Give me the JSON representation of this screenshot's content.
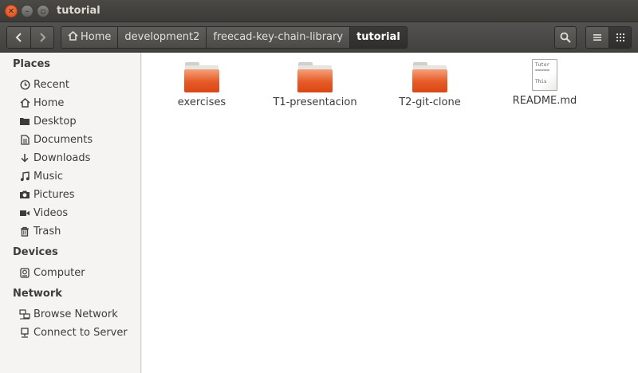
{
  "window": {
    "title": "tutorial"
  },
  "toolbar": {
    "back_icon": "chevron-left-icon",
    "forward_icon": "chevron-right-icon",
    "breadcrumbs": [
      {
        "label": "Home",
        "icon": "home-icon"
      },
      {
        "label": "development2"
      },
      {
        "label": "freecad-key-chain-library"
      },
      {
        "label": "tutorial"
      }
    ],
    "search_icon": "search-icon",
    "list_view_icon": "list-view-icon",
    "grid_view_icon": "grid-view-icon"
  },
  "sidebar": {
    "places_header": "Places",
    "places": [
      {
        "label": "Recent",
        "icon": "recent-icon"
      },
      {
        "label": "Home",
        "icon": "home-icon"
      },
      {
        "label": "Desktop",
        "icon": "desktop-icon"
      },
      {
        "label": "Documents",
        "icon": "documents-icon"
      },
      {
        "label": "Downloads",
        "icon": "downloads-icon"
      },
      {
        "label": "Music",
        "icon": "music-icon"
      },
      {
        "label": "Pictures",
        "icon": "pictures-icon"
      },
      {
        "label": "Videos",
        "icon": "videos-icon"
      },
      {
        "label": "Trash",
        "icon": "trash-icon"
      }
    ],
    "devices_header": "Devices",
    "devices": [
      {
        "label": "Computer",
        "icon": "computer-icon"
      }
    ],
    "network_header": "Network",
    "network": [
      {
        "label": "Browse Network",
        "icon": "network-icon"
      },
      {
        "label": "Connect to Server",
        "icon": "server-icon"
      }
    ]
  },
  "files": [
    {
      "name": "exercises",
      "type": "folder"
    },
    {
      "name": "T1-presentacion",
      "type": "folder"
    },
    {
      "name": "T2-git-clone",
      "type": "folder"
    },
    {
      "name": "README.md",
      "type": "text",
      "preview": [
        "Tutor",
        "=====",
        "",
        "This"
      ]
    }
  ],
  "colors": {
    "accent": "#dd4814",
    "folder": "#e55a26",
    "titlebar": "#3c3b37"
  }
}
